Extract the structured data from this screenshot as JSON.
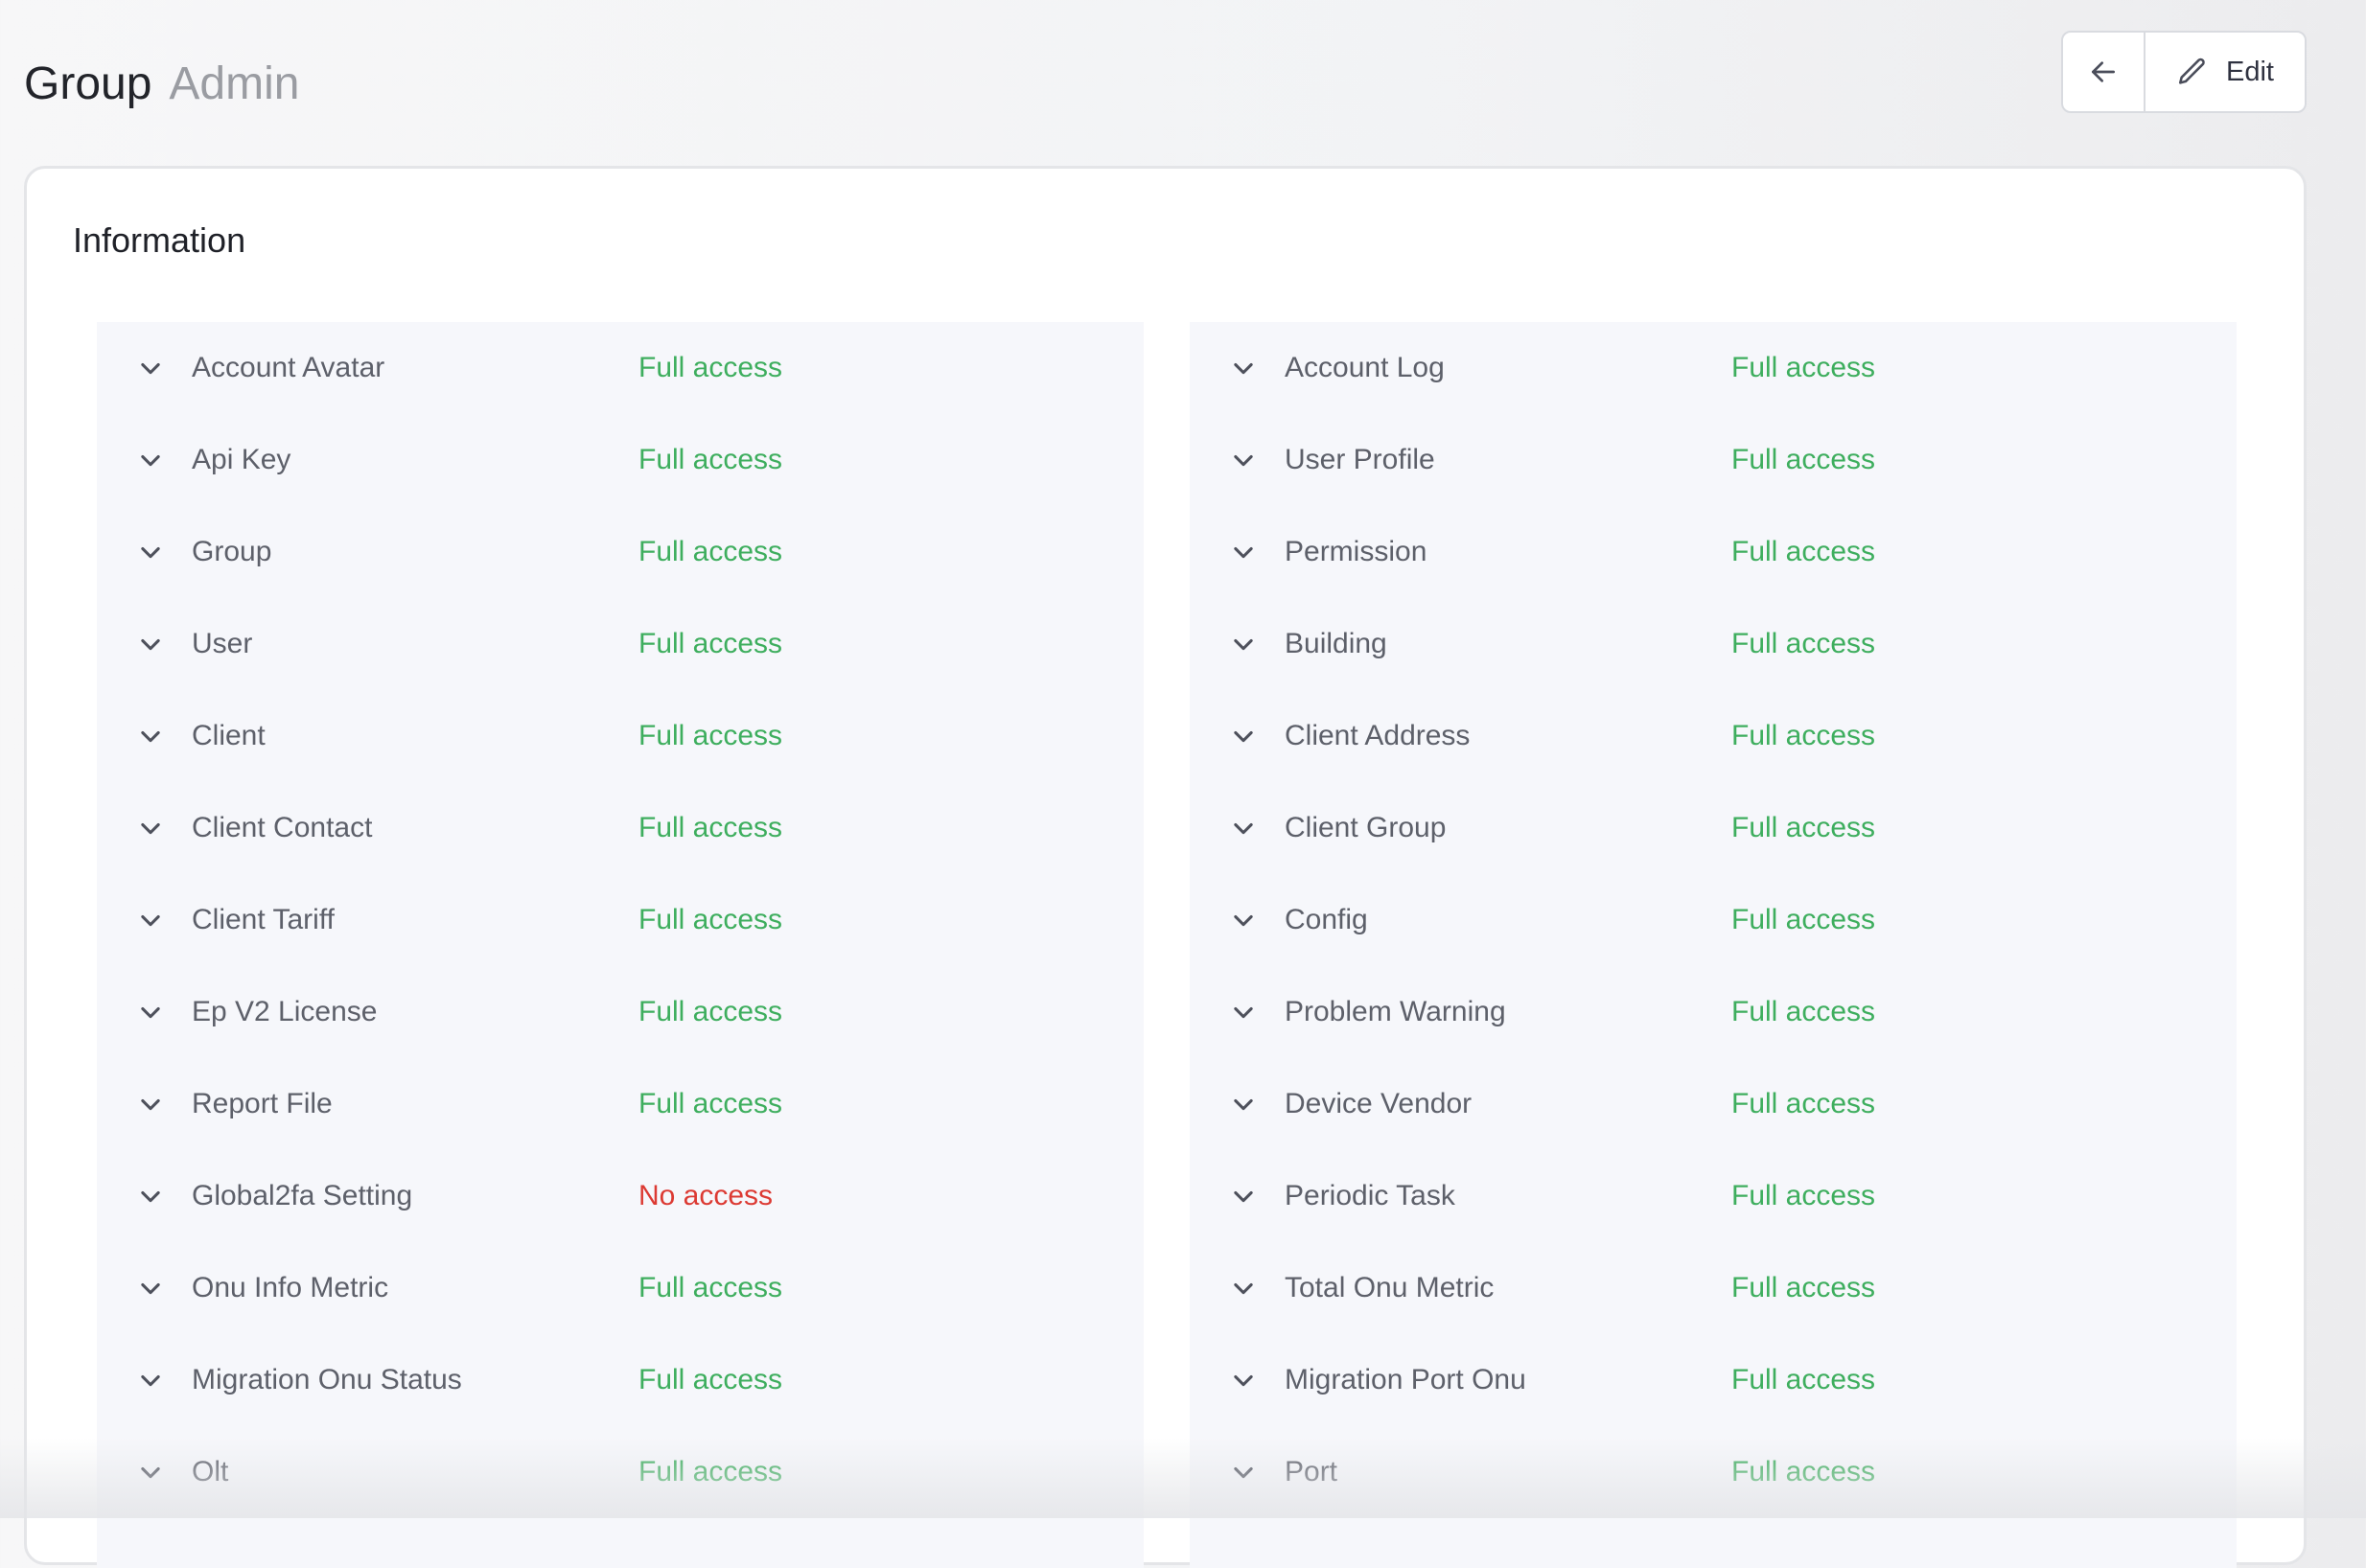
{
  "header": {
    "title": "Group",
    "subtitle": "Admin",
    "edit_label": "Edit",
    "back_icon": "arrow-left-icon",
    "edit_icon": "pencil-icon"
  },
  "card": {
    "title": "Information"
  },
  "colors": {
    "full_access": "#3eae5e",
    "no_access": "#dc3a33",
    "panel_bg": "#f6f7fb"
  },
  "permissions_left": [
    {
      "name": "Account Avatar",
      "access": "Full access",
      "status": "full"
    },
    {
      "name": "Api Key",
      "access": "Full access",
      "status": "full"
    },
    {
      "name": "Group",
      "access": "Full access",
      "status": "full"
    },
    {
      "name": "User",
      "access": "Full access",
      "status": "full"
    },
    {
      "name": "Client",
      "access": "Full access",
      "status": "full"
    },
    {
      "name": "Client Contact",
      "access": "Full access",
      "status": "full"
    },
    {
      "name": "Client Tariff",
      "access": "Full access",
      "status": "full"
    },
    {
      "name": "Ep V2 License",
      "access": "Full access",
      "status": "full"
    },
    {
      "name": "Report File",
      "access": "Full access",
      "status": "full"
    },
    {
      "name": "Global2fa Setting",
      "access": "No access",
      "status": "none"
    },
    {
      "name": "Onu Info Metric",
      "access": "Full access",
      "status": "full"
    },
    {
      "name": "Migration Onu Status",
      "access": "Full access",
      "status": "full"
    },
    {
      "name": "Olt",
      "access": "Full access",
      "status": "full"
    }
  ],
  "permissions_right": [
    {
      "name": "Account Log",
      "access": "Full access",
      "status": "full"
    },
    {
      "name": "User Profile",
      "access": "Full access",
      "status": "full"
    },
    {
      "name": "Permission",
      "access": "Full access",
      "status": "full"
    },
    {
      "name": "Building",
      "access": "Full access",
      "status": "full"
    },
    {
      "name": "Client Address",
      "access": "Full access",
      "status": "full"
    },
    {
      "name": "Client Group",
      "access": "Full access",
      "status": "full"
    },
    {
      "name": "Config",
      "access": "Full access",
      "status": "full"
    },
    {
      "name": "Problem Warning",
      "access": "Full access",
      "status": "full"
    },
    {
      "name": "Device Vendor",
      "access": "Full access",
      "status": "full"
    },
    {
      "name": "Periodic Task",
      "access": "Full access",
      "status": "full"
    },
    {
      "name": "Total Onu Metric",
      "access": "Full access",
      "status": "full"
    },
    {
      "name": "Migration Port Onu",
      "access": "Full access",
      "status": "full"
    },
    {
      "name": "Port",
      "access": "Full access",
      "status": "full"
    }
  ]
}
